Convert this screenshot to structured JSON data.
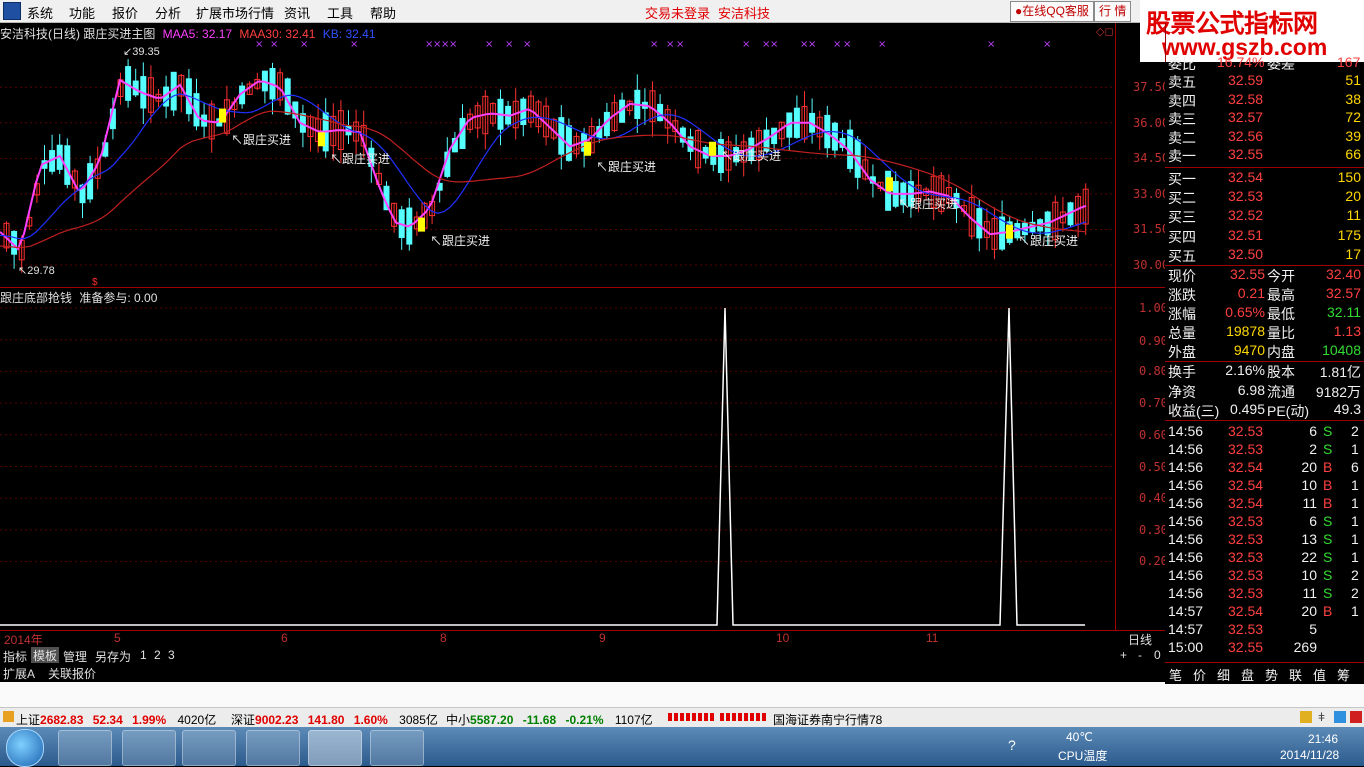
{
  "menu": {
    "items": [
      "系统",
      "功能",
      "报价",
      "分析",
      "扩展市场行情",
      "资讯",
      "工具",
      "帮助"
    ],
    "status_login": "交易未登录",
    "status_stock": "安洁科技",
    "qq_button": "在线QQ客服",
    "mode_button": "行 情"
  },
  "brand": {
    "line1": "股票公式指标网",
    "line2": "www.gszb.com"
  },
  "price_chart": {
    "title": "安洁科技(日线) 跟庄买进主图",
    "maa5_label": "MAA5: 32.17",
    "maa30_label": "MAA30: 32.41",
    "kb_label": "KB: 32.41",
    "high_marker": "39.35",
    "low_marker": "29.78",
    "y_ticks": [
      "37.50",
      "36.00",
      "34.50",
      "33.00",
      "31.50",
      "30.00"
    ],
    "signal_label": "跟庄买进",
    "colors": {
      "up": "#ff3030",
      "down": "#55ffff",
      "ma5": "#ff40ff",
      "ma30": "#2030ff",
      "kb": "#c02020",
      "signal": "#ffff00"
    }
  },
  "indicator": {
    "title": "跟庄底部抢钱",
    "value_label": "准备参与: 0.00",
    "y_ticks": [
      "1.00",
      "0.90",
      "0.80",
      "0.70",
      "0.60",
      "0.50",
      "0.40",
      "0.30",
      "0.20"
    ]
  },
  "time_axis": {
    "labels": [
      "2014年",
      "5",
      "6",
      "8",
      "9",
      "10",
      "11"
    ],
    "period": "日线"
  },
  "chart_data": {
    "type": "line",
    "title": "跟庄底部抢钱",
    "series": [
      {
        "name": "准备参与",
        "values": [
          0,
          0,
          0,
          1.0,
          0,
          0,
          1.0,
          0,
          0
        ]
      }
    ],
    "ylim": [
      0,
      1.0
    ]
  },
  "quote": {
    "cut_header": [
      "委比",
      "16.74%",
      "委差",
      "167"
    ],
    "asks": [
      {
        "label": "卖五",
        "price": "32.59",
        "vol": "51"
      },
      {
        "label": "卖四",
        "price": "32.58",
        "vol": "38"
      },
      {
        "label": "卖三",
        "price": "32.57",
        "vol": "72"
      },
      {
        "label": "卖二",
        "price": "32.56",
        "vol": "39"
      },
      {
        "label": "卖一",
        "price": "32.55",
        "vol": "66"
      }
    ],
    "bids": [
      {
        "label": "买一",
        "price": "32.54",
        "vol": "150"
      },
      {
        "label": "买二",
        "price": "32.53",
        "vol": "20"
      },
      {
        "label": "买三",
        "price": "32.52",
        "vol": "11"
      },
      {
        "label": "买四",
        "price": "32.51",
        "vol": "175"
      },
      {
        "label": "买五",
        "price": "32.50",
        "vol": "17"
      }
    ],
    "stats": [
      {
        "l1": "现价",
        "v1": "32.55",
        "l2": "今开",
        "v2": "32.40"
      },
      {
        "l1": "涨跌",
        "v1": "0.21",
        "l2": "最高",
        "v2": "32.57"
      },
      {
        "l1": "涨幅",
        "v1": "0.65%",
        "l2": "最低",
        "v2": "32.11"
      },
      {
        "l1": "总量",
        "v1": "19878",
        "l2": "量比",
        "v2": "1.13"
      },
      {
        "l1": "外盘",
        "v1": "9470",
        "l2": "内盘",
        "v2": "10408"
      }
    ],
    "fundamentals": [
      {
        "l1": "换手",
        "v1": "2.16%",
        "l2": "股本",
        "v2": "1.81亿"
      },
      {
        "l1": "净资",
        "v1": "6.98",
        "l2": "流通",
        "v2": "9182万"
      },
      {
        "l1": "收益(三)",
        "v1": "0.495",
        "l2": "PE(动)",
        "v2": "49.3"
      }
    ],
    "ticks": [
      {
        "t": "14:56",
        "p": "32.53",
        "v": "6",
        "s": "S",
        "n": "2"
      },
      {
        "t": "14:56",
        "p": "32.53",
        "v": "2",
        "s": "S",
        "n": "1"
      },
      {
        "t": "14:56",
        "p": "32.54",
        "v": "20",
        "s": "B",
        "n": "6"
      },
      {
        "t": "14:56",
        "p": "32.54",
        "v": "10",
        "s": "B",
        "n": "1"
      },
      {
        "t": "14:56",
        "p": "32.54",
        "v": "11",
        "s": "B",
        "n": "1"
      },
      {
        "t": "14:56",
        "p": "32.53",
        "v": "6",
        "s": "S",
        "n": "1"
      },
      {
        "t": "14:56",
        "p": "32.53",
        "v": "13",
        "s": "S",
        "n": "1"
      },
      {
        "t": "14:56",
        "p": "32.53",
        "v": "22",
        "s": "S",
        "n": "1"
      },
      {
        "t": "14:56",
        "p": "32.53",
        "v": "10",
        "s": "S",
        "n": "2"
      },
      {
        "t": "14:56",
        "p": "32.53",
        "v": "11",
        "s": "S",
        "n": "2"
      },
      {
        "t": "14:57",
        "p": "32.54",
        "v": "20",
        "s": "B",
        "n": "1"
      },
      {
        "t": "14:57",
        "p": "32.53",
        "v": "5",
        "s": "",
        "n": ""
      },
      {
        "t": "15:00",
        "p": "32.55",
        "v": "269",
        "s": "",
        "n": ""
      }
    ],
    "bottom_tabs": [
      "笔",
      "价",
      "细",
      "盘",
      "势",
      "联",
      "值",
      "筹"
    ]
  },
  "tabs": {
    "items": [
      "指标",
      "模板",
      "管理",
      "另存为",
      "1",
      "2",
      "3"
    ],
    "ext": [
      "扩展A",
      "关联报价"
    ],
    "controls": [
      "+",
      "-",
      "0"
    ]
  },
  "ticker": {
    "sh": {
      "name": "上证",
      "price": "2682.83",
      "chg": "52.34",
      "pct": "1.99%",
      "amt": "4020亿"
    },
    "sz": {
      "name": "深证",
      "price": "9002.23",
      "chg": "141.80",
      "pct": "1.60%",
      "amt": "3085亿"
    },
    "zx": {
      "name": "中小",
      "price": "5587.20",
      "chg": "-11.68",
      "pct": "-0.21%",
      "amt": "1107亿"
    },
    "broker": "国海证券南宁行情78"
  },
  "taskbar": {
    "temp": "40℃",
    "cpu_label": "CPU温度",
    "time": "21:46",
    "date": "2014/11/28"
  }
}
